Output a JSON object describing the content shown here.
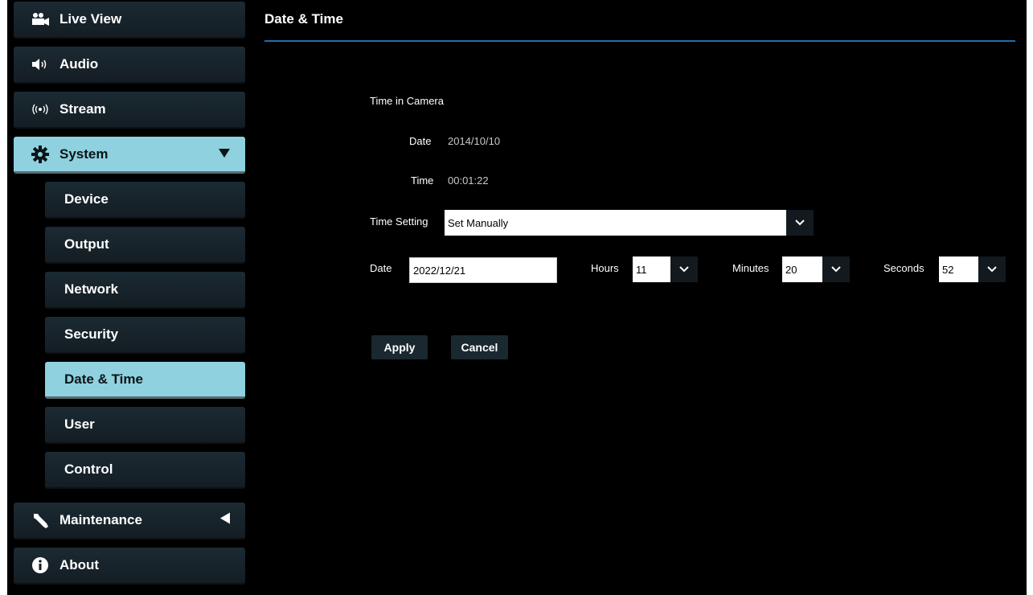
{
  "nav": {
    "items": [
      {
        "label": "Live View",
        "icon": "video-camera-icon"
      },
      {
        "label": "Audio",
        "icon": "speaker-icon"
      },
      {
        "label": "Stream",
        "icon": "broadcast-icon"
      },
      {
        "label": "System",
        "icon": "gear-icon"
      },
      {
        "label": "Maintenance",
        "icon": "wrench-icon"
      },
      {
        "label": "About",
        "icon": "info-icon"
      }
    ],
    "sub_items": [
      "Device",
      "Output",
      "Network",
      "Security",
      "Date & Time",
      "User",
      "Control"
    ],
    "active_sub": "Date & Time"
  },
  "page": {
    "title": "Date & Time",
    "time_in_camera_label": "Time in Camera",
    "camera_date_label": "Date",
    "camera_date_value": "2014/10/10",
    "camera_time_label": "Time",
    "camera_time_value": "00:01:22",
    "time_setting_label": "Time Setting",
    "time_setting_value": "Set Manually",
    "date_label": "Date",
    "date_value": "2022/12/21",
    "hours_label": "Hours",
    "hours_value": "11",
    "minutes_label": "Minutes",
    "minutes_value": "20",
    "seconds_label": "Seconds",
    "seconds_value": "52",
    "apply_label": "Apply",
    "cancel_label": "Cancel"
  },
  "colors": {
    "accent": "#8fd1de",
    "header_line": "#1f6fb2",
    "background": "#000000"
  }
}
